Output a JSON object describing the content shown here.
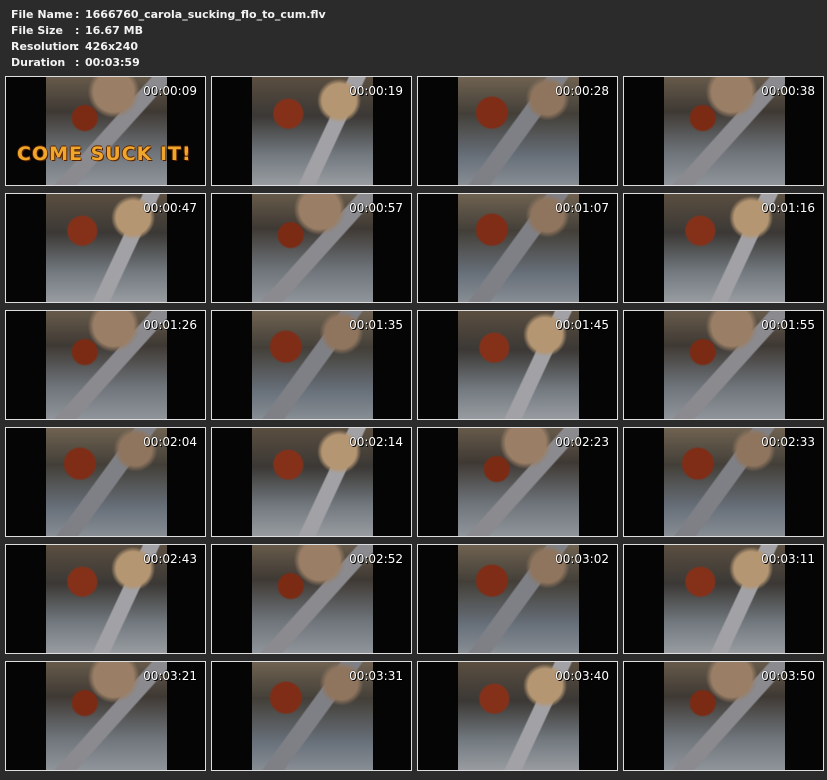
{
  "file_info": {
    "file_name_label": "File Name",
    "file_name_value": "1666760_carola_sucking_flo_to_cum.flv",
    "file_size_label": "File Size",
    "file_size_value": "16.67 MB",
    "resolution_label": "Resolution",
    "resolution_value": "426x240",
    "duration_label": "Duration",
    "duration_value": "00:03:59",
    "separator": ":"
  },
  "thumbnails": [
    {
      "timestamp": "00:00:09",
      "overlay_text": "COME SUCK IT!"
    },
    {
      "timestamp": "00:00:19"
    },
    {
      "timestamp": "00:00:28"
    },
    {
      "timestamp": "00:00:38"
    },
    {
      "timestamp": "00:00:47"
    },
    {
      "timestamp": "00:00:57"
    },
    {
      "timestamp": "00:01:07"
    },
    {
      "timestamp": "00:01:16"
    },
    {
      "timestamp": "00:01:26"
    },
    {
      "timestamp": "00:01:35"
    },
    {
      "timestamp": "00:01:45"
    },
    {
      "timestamp": "00:01:55"
    },
    {
      "timestamp": "00:02:04"
    },
    {
      "timestamp": "00:02:14"
    },
    {
      "timestamp": "00:02:23"
    },
    {
      "timestamp": "00:02:33"
    },
    {
      "timestamp": "00:02:43"
    },
    {
      "timestamp": "00:02:52"
    },
    {
      "timestamp": "00:03:02"
    },
    {
      "timestamp": "00:03:11"
    },
    {
      "timestamp": "00:03:21"
    },
    {
      "timestamp": "00:03:31"
    },
    {
      "timestamp": "00:03:40"
    },
    {
      "timestamp": "00:03:50"
    }
  ],
  "colors": {
    "background": "#2b2b2b",
    "text": "#f2f2f2",
    "thumbnail_border": "#dedede",
    "overlay_text": "#f0a62a"
  }
}
